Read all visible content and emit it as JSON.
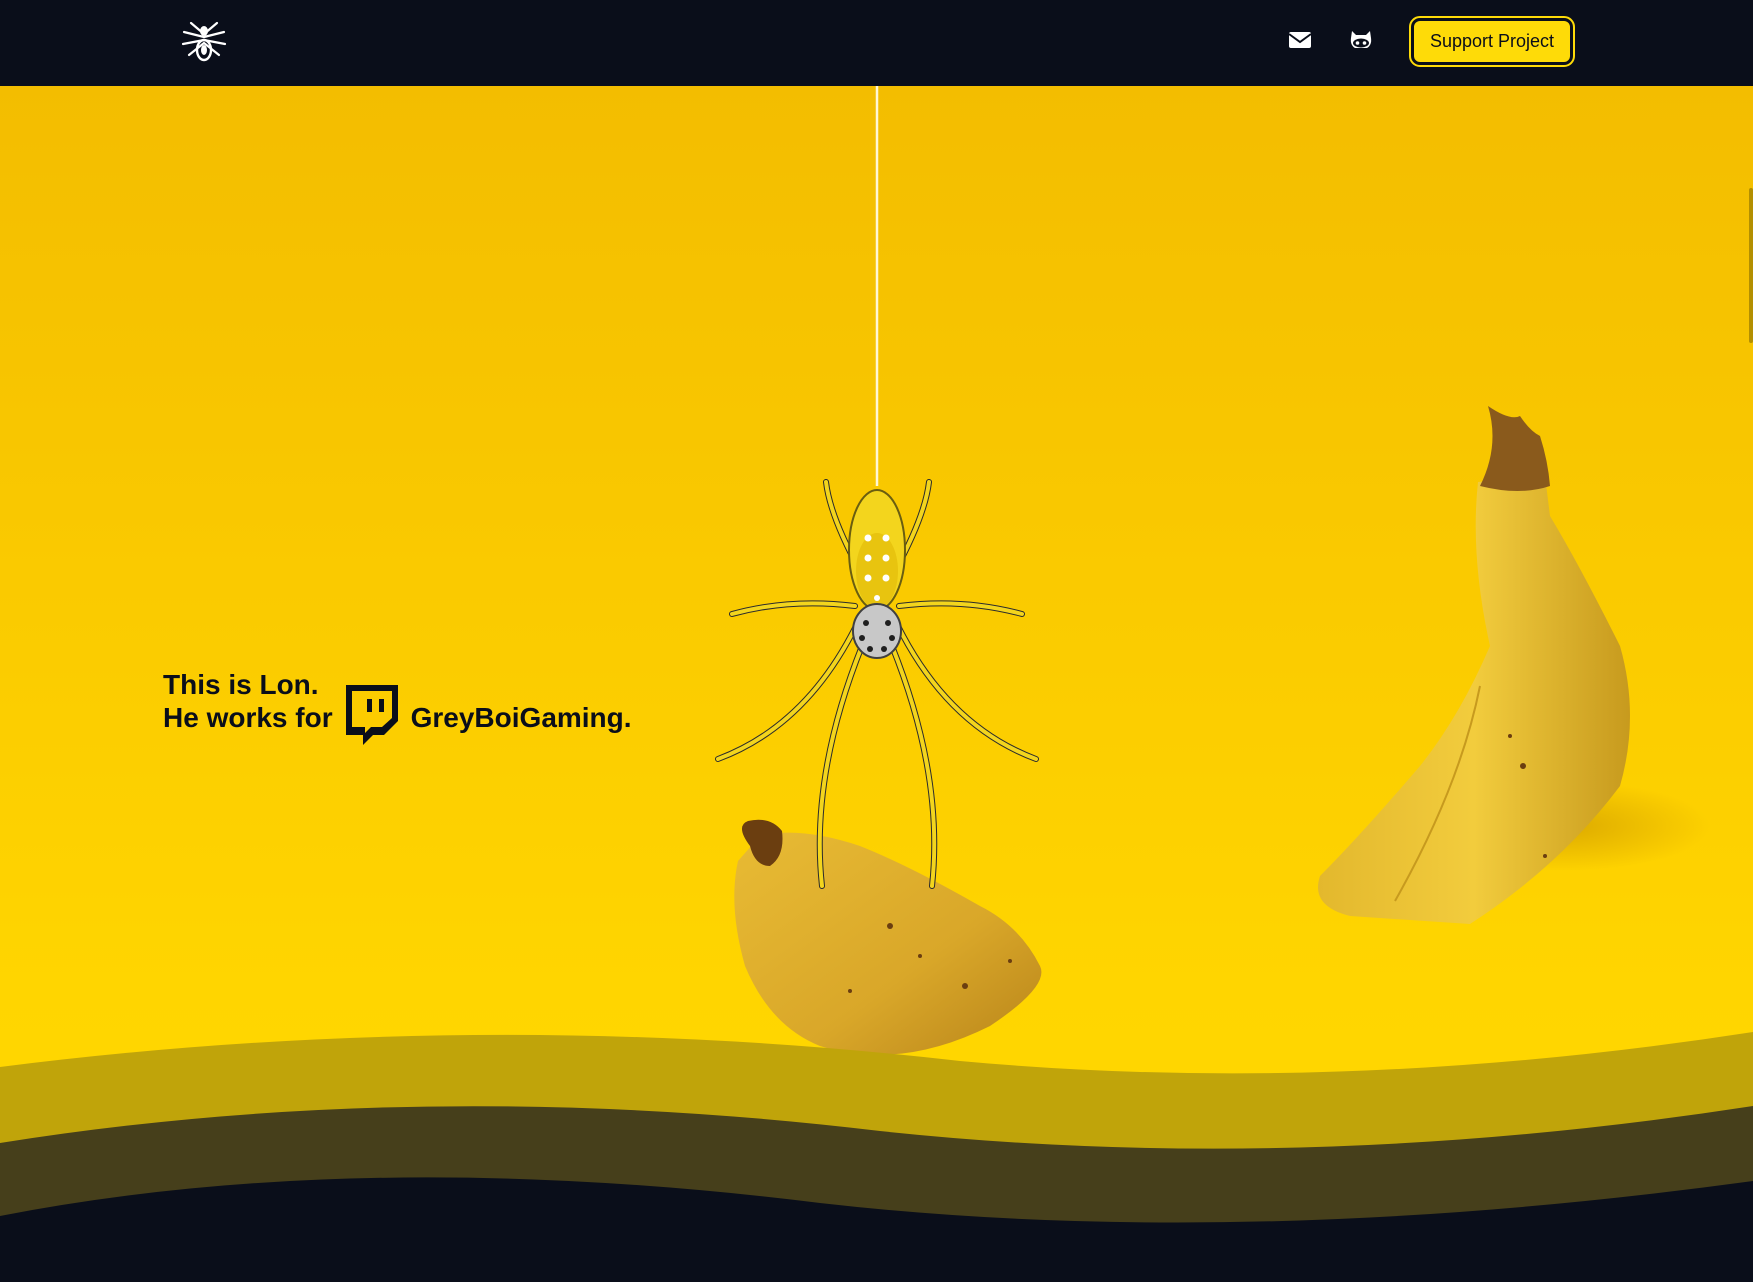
{
  "navbar": {
    "logo_icon": "spider-logo-icon",
    "mail_icon": "envelope-icon",
    "github_icon": "github-icon",
    "support_button_label": "Support Project"
  },
  "hero": {
    "line1": "This is Lon.",
    "line2_prefix": "He works for",
    "brand_icon": "twitch-icon",
    "line2_suffix": "GreyBoiGaming."
  },
  "colors": {
    "navbar_bg": "#0a0e1a",
    "accent_yellow": "#fedb08",
    "hero_yellow": "#ffd500",
    "wave_olive": "#c0a40a",
    "wave_dark": "#463f1b"
  }
}
